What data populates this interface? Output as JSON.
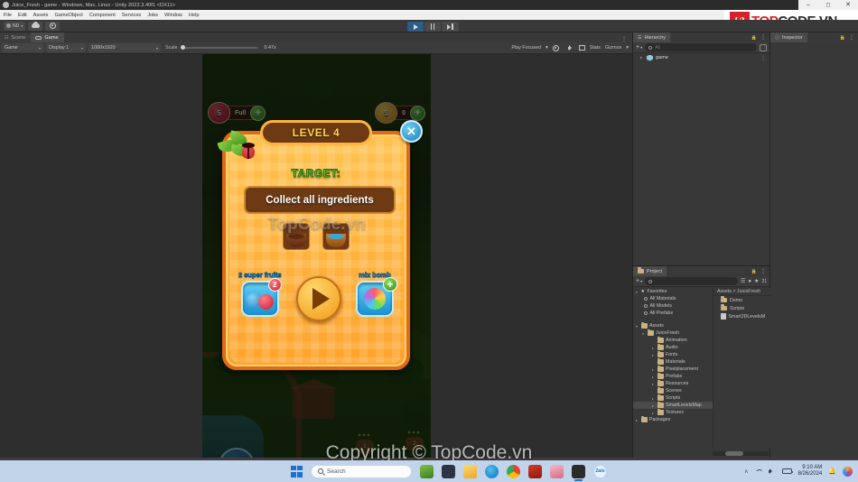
{
  "window": {
    "title": "Juice_Fresh - game - Windows, Mac, Linux - Unity 2022.3.40f1 <DX11>",
    "minimize": "–",
    "maximize": "⬜",
    "close": "✕"
  },
  "menubar": {
    "items": [
      "File",
      "Edit",
      "Assets",
      "GameObject",
      "Component",
      "Services",
      "Jobs",
      "Window",
      "Help"
    ]
  },
  "toolbar": {
    "account": "ND",
    "account_caret": "▾",
    "cloud_icon": "cloud-icon",
    "settings_icon": "gear-icon",
    "play": "▶",
    "pause": "‖",
    "step": "▶|"
  },
  "game_view": {
    "tabs": [
      {
        "label": "Scene",
        "icon": "#",
        "selected": false
      },
      {
        "label": "Game",
        "icon": "game-icon",
        "selected": true
      }
    ],
    "tab_menu": "⋮",
    "target_dropdown": "Game",
    "display_dropdown": "Display 1",
    "resolution_dropdown": "1080x1920",
    "scale_label": "Scale",
    "scale_value": "0.47x",
    "play_focused": "Play Focused",
    "mute_icon": "speaker-icon",
    "stats_label": "Stats",
    "gizmos_label": "Gizmos",
    "gizmos_caret": "▾",
    "caret": "▾"
  },
  "game": {
    "hud": {
      "lives_count": "5",
      "lives_status": "Full",
      "lives_plus": "+",
      "coins_count": "0",
      "coins_plus": "+"
    },
    "popup": {
      "level_label": "LEVEL 4",
      "close": "✕",
      "target_label": "TARGET:",
      "goal_text": "Collect all ingredients",
      "ingredients": [
        "chocolate-bowl",
        "blue-juice-bowl"
      ],
      "boosters": [
        {
          "label": "2 super fruits",
          "badge": "2",
          "badge_type": "count"
        },
        {
          "label": "mix bomb",
          "badge": "+",
          "badge_type": "add"
        }
      ],
      "play_button": "play-icon"
    },
    "map": {
      "settings_button": "gear-icon",
      "level_nodes": [
        "1",
        "2"
      ]
    },
    "watermark": "TopCode.vn"
  },
  "hierarchy": {
    "tab_label": "Hierarchy",
    "tab_icon": "hierarchy-icon",
    "lock_icon": "🔒",
    "menu_icon": "⋮",
    "add_button": "+",
    "add_caret": "▾",
    "search_placeholder": "All",
    "search_icon": "search-icon",
    "items": [
      {
        "label": "game",
        "arrow": "▸",
        "icon": "scene-icon",
        "kebab": "⋮"
      }
    ]
  },
  "inspector": {
    "tab_label": "Inspector",
    "tab_icon": "ⓘ",
    "lock_icon": "🔒",
    "menu_icon": "⋮"
  },
  "project": {
    "tab_label": "Project",
    "tab_icon": "folder-icon",
    "lock_icon": "🔒",
    "menu_icon": "⋮",
    "add_button": "+",
    "add_caret": "▾",
    "search_placeholder": "",
    "count_badge": "21",
    "eye_icon": "eye-icon",
    "favorites_label": "Favorites",
    "favorites": [
      "All Materials",
      "All Models",
      "All Prefabs"
    ],
    "assets_label": "Assets",
    "root_folder": "JuiceFresh",
    "folders": [
      {
        "label": "Animation",
        "arrow": ""
      },
      {
        "label": "Audio",
        "arrow": "▸"
      },
      {
        "label": "Fonts",
        "arrow": "▸"
      },
      {
        "label": "Materials",
        "arrow": ""
      },
      {
        "label": "Pixelplacement",
        "arrow": "▸"
      },
      {
        "label": "Prefabs",
        "arrow": "▸"
      },
      {
        "label": "Resources",
        "arrow": "▸"
      },
      {
        "label": "Scenes",
        "arrow": ""
      },
      {
        "label": "Scripts",
        "arrow": "▸"
      },
      {
        "label": "SmartLevelsMap",
        "arrow": "▸",
        "selected": true
      },
      {
        "label": "Textures",
        "arrow": "▸"
      }
    ],
    "packages_label": "Packages",
    "packages_arrow": "▸",
    "breadcrumb": "Assets  >  JuiceFresh",
    "assets": [
      {
        "label": "Demo",
        "type": "folder"
      },
      {
        "label": "Scripts",
        "type": "folder"
      },
      {
        "label": "Smart2DLevelsM",
        "type": "file"
      }
    ]
  },
  "logo": {
    "mark": "{/}",
    "text_top": "TOP",
    "text_code": "CODE",
    "text_dot": ".",
    "text_vn": "VN"
  },
  "watermark_bottom": "Copyright © TopCode.vn",
  "taskbar": {
    "start_icon": "windows-icon",
    "search_placeholder": "Search",
    "search_icon": "search-icon",
    "apps": [
      "running-app-icon",
      "file-explorer-icon",
      "explorer-icon",
      "edge-icon",
      "chrome-icon",
      "red-app-icon",
      "pink-app-icon",
      "unity-icon",
      "zalo-icon"
    ],
    "tray": {
      "chevron": "∧",
      "wifi_icon": "wifi-icon",
      "volume_icon": "volume-icon",
      "battery_icon": "battery-icon",
      "time": "9:10 AM",
      "date": "8/26/2024",
      "bell_icon": "🔔",
      "widget_icon": "widget-icon"
    }
  }
}
